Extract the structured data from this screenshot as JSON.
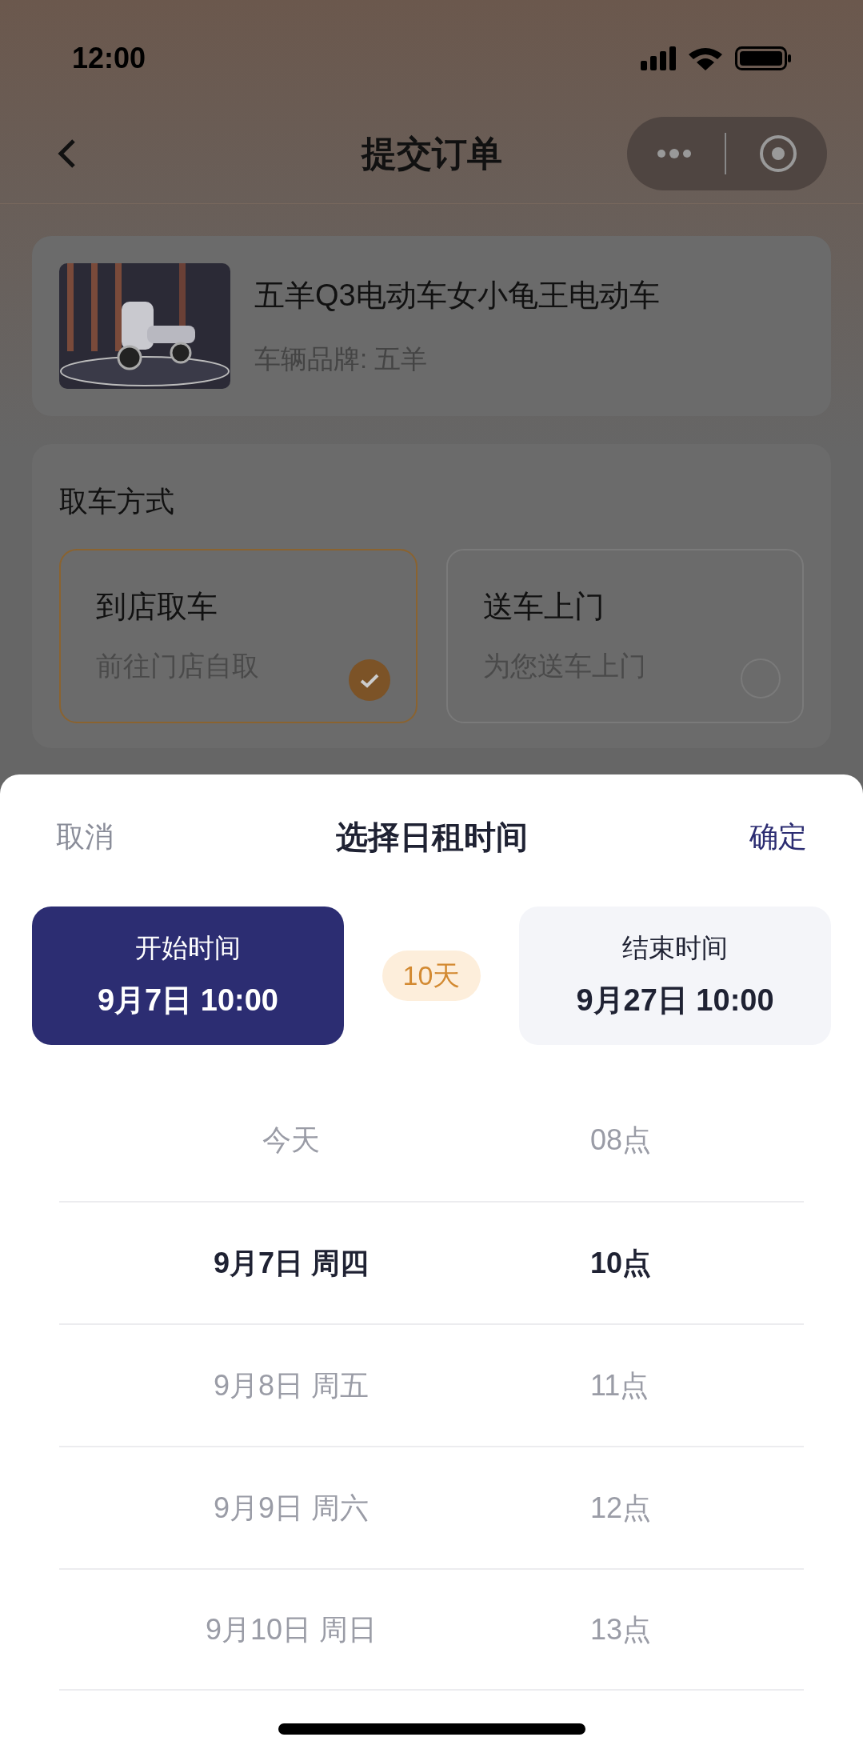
{
  "status_bar": {
    "time": "12:00"
  },
  "nav": {
    "title": "提交订单"
  },
  "product": {
    "name": "五羊Q3电动车女小龟王电动车",
    "brand": "车辆品牌: 五羊"
  },
  "pickup": {
    "title": "取车方式",
    "options": [
      {
        "title": "到店取车",
        "subtitle": "前往门店自取",
        "selected": true
      },
      {
        "title": "送车上门",
        "subtitle": "为您送车上门",
        "selected": false
      }
    ]
  },
  "sheet": {
    "cancel": "取消",
    "title": "选择日租时间",
    "confirm": "确定",
    "start": {
      "label": "开始时间",
      "value": "9月7日 10:00",
      "selected": true
    },
    "duration": "10天",
    "end": {
      "label": "结束时间",
      "value": "9月27日 10:00",
      "selected": false
    },
    "rows": [
      {
        "date": "今天",
        "hour": "08点",
        "selected": false
      },
      {
        "date": "9月7日 周四",
        "hour": "10点",
        "selected": true
      },
      {
        "date": "9月8日 周五",
        "hour": "11点",
        "selected": false
      },
      {
        "date": "9月9日 周六",
        "hour": "12点",
        "selected": false
      },
      {
        "date": "9月10日 周日",
        "hour": "13点",
        "selected": false
      }
    ]
  }
}
